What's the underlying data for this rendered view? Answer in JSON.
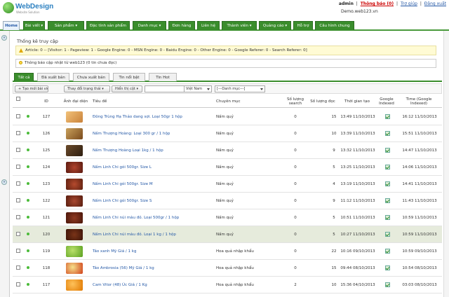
{
  "header": {
    "logo_text": "WebDesign",
    "logo_tagline": "Website Solution",
    "user": "admin",
    "notify_link": "Thông báo (0)",
    "help_link": "Trợ giúp",
    "logout_link": "Đăng xuất",
    "domain": "Demo.web123.vn"
  },
  "nav": {
    "tabs": [
      "Home",
      "Bài viết ▾",
      "Sản phẩm ▾",
      "Đặc tính sản phẩm",
      "Danh mục ▾",
      "Đơn hàng",
      "Liên hệ",
      "Thành viên ▾",
      "Quảng cáo ▾",
      "Hỗ trợ",
      "Câu hình chung"
    ]
  },
  "stats": {
    "title": "Thống kê truy cập",
    "line": "Article: 0 -- [Visitor: 1 - Pageview: 1 - Google Engine: 0 - MSN Engine: 0 - Baidu Engine: 0 - Other Engine: 0 - Google Referer: 0 - Search Referer: 0]",
    "notice": "Thông báo cập nhật từ web123 (0 tin chưa đọc)"
  },
  "subtabs": [
    "Tất cả",
    "Đã xuất bản",
    "Chưa xuất bản",
    "Tin nổi bật",
    "Tin Hot"
  ],
  "toolbar": {
    "add_button": "+ Tạo mới bài viết",
    "status_button": "Thay đổi trạng thái ▾",
    "columns_button": "Hiển thị cột ▾",
    "language_select": "Việt Nam",
    "category_select": "[---Danh mục---]"
  },
  "table": {
    "headers": {
      "id": "ID",
      "image": "Ảnh đại diện",
      "title": "Tiêu đề",
      "category": "Chuyên mục",
      "qty_search": "Số lượng search",
      "qty_read": "Số lượng đọc",
      "created": "Thời gian tạo",
      "google_indexed": "Google Indexed",
      "time": "Time (Google Indexed)"
    },
    "rows": [
      {
        "id": "127",
        "title": "Đông Trùng Hạ Thảo dang sợi. Loại 50gr 1 hộp",
        "category": "Nấm quý",
        "search": "0",
        "read": "15",
        "created": "13:49 11/10/2013",
        "indexed_time": "16:12 11/10/2013"
      },
      {
        "id": "126",
        "title": "Nấm Thượng Hoàng: Loại 300 gr / 1 hộp",
        "category": "Nấm quý",
        "search": "0",
        "read": "10",
        "created": "13:39 11/10/2013",
        "indexed_time": "15:51 11/10/2013"
      },
      {
        "id": "125",
        "title": "Nấm Thượng Hoàng Loại 1kg / 1 hộp",
        "category": "Nấm quý",
        "search": "0",
        "read": "9",
        "created": "13:32 11/10/2013",
        "indexed_time": "14:47 11/10/2013"
      },
      {
        "id": "124",
        "title": "Nấm Linh Chi gói 500gr. Size L",
        "category": "Nấm quý",
        "search": "0",
        "read": "5",
        "created": "13:25 11/10/2013",
        "indexed_time": "14:06 11/10/2013"
      },
      {
        "id": "123",
        "title": "Nấm Linh Chi gói 500gr. Size M",
        "category": "Nấm quý",
        "search": "0",
        "read": "4",
        "created": "13:19 11/10/2013",
        "indexed_time": "14:41 11/10/2013"
      },
      {
        "id": "122",
        "title": "Nấm Linh Chi gói 500gr. Size S",
        "category": "Nấm quý",
        "search": "0",
        "read": "9",
        "created": "11:12 11/10/2013",
        "indexed_time": "11:43 11/10/2013"
      },
      {
        "id": "121",
        "title": "Nấm Linh Chi núi màu đỏ. Loại 500gr / 1 hộp",
        "category": "Nấm quý",
        "search": "0",
        "read": "5",
        "created": "10:51 11/10/2013",
        "indexed_time": "10:59 11/10/2013"
      },
      {
        "id": "120",
        "title": "Nấm Linh Chi núi màu đỏ. Loại 1 kg / 1 hộp",
        "category": "Nấm quý",
        "search": "0",
        "read": "5",
        "created": "10:27 11/10/2013",
        "indexed_time": "10:59 11/10/2013"
      },
      {
        "id": "119",
        "title": "Táo xanh Mỹ Giá / 1 kg",
        "category": "Hoa quả nhập khẩu",
        "search": "0",
        "read": "22",
        "created": "10:16 09/10/2013",
        "indexed_time": "10:59 09/10/2013"
      },
      {
        "id": "118",
        "title": "Táo Ambrosia (56) Mỹ Giá / 1 kg",
        "category": "Hoa quả nhập khẩu",
        "search": "0",
        "read": "15",
        "created": "09:44 08/10/2013",
        "indexed_time": "10:54 08/10/2013"
      },
      {
        "id": "117",
        "title": "Cam Vitor (48) Úc Giá / 1 Kg",
        "category": "Hoa quả nhập khẩu",
        "search": "2",
        "read": "10",
        "created": "15:36 04/10/2013",
        "indexed_time": "03:03 08/10/2013"
      }
    ]
  },
  "colors": {
    "nav_green": "#3a8d2c",
    "link_blue": "#2458a6",
    "status_dot": "#4cbb3a",
    "highlight_row": "#e6ebdc"
  }
}
